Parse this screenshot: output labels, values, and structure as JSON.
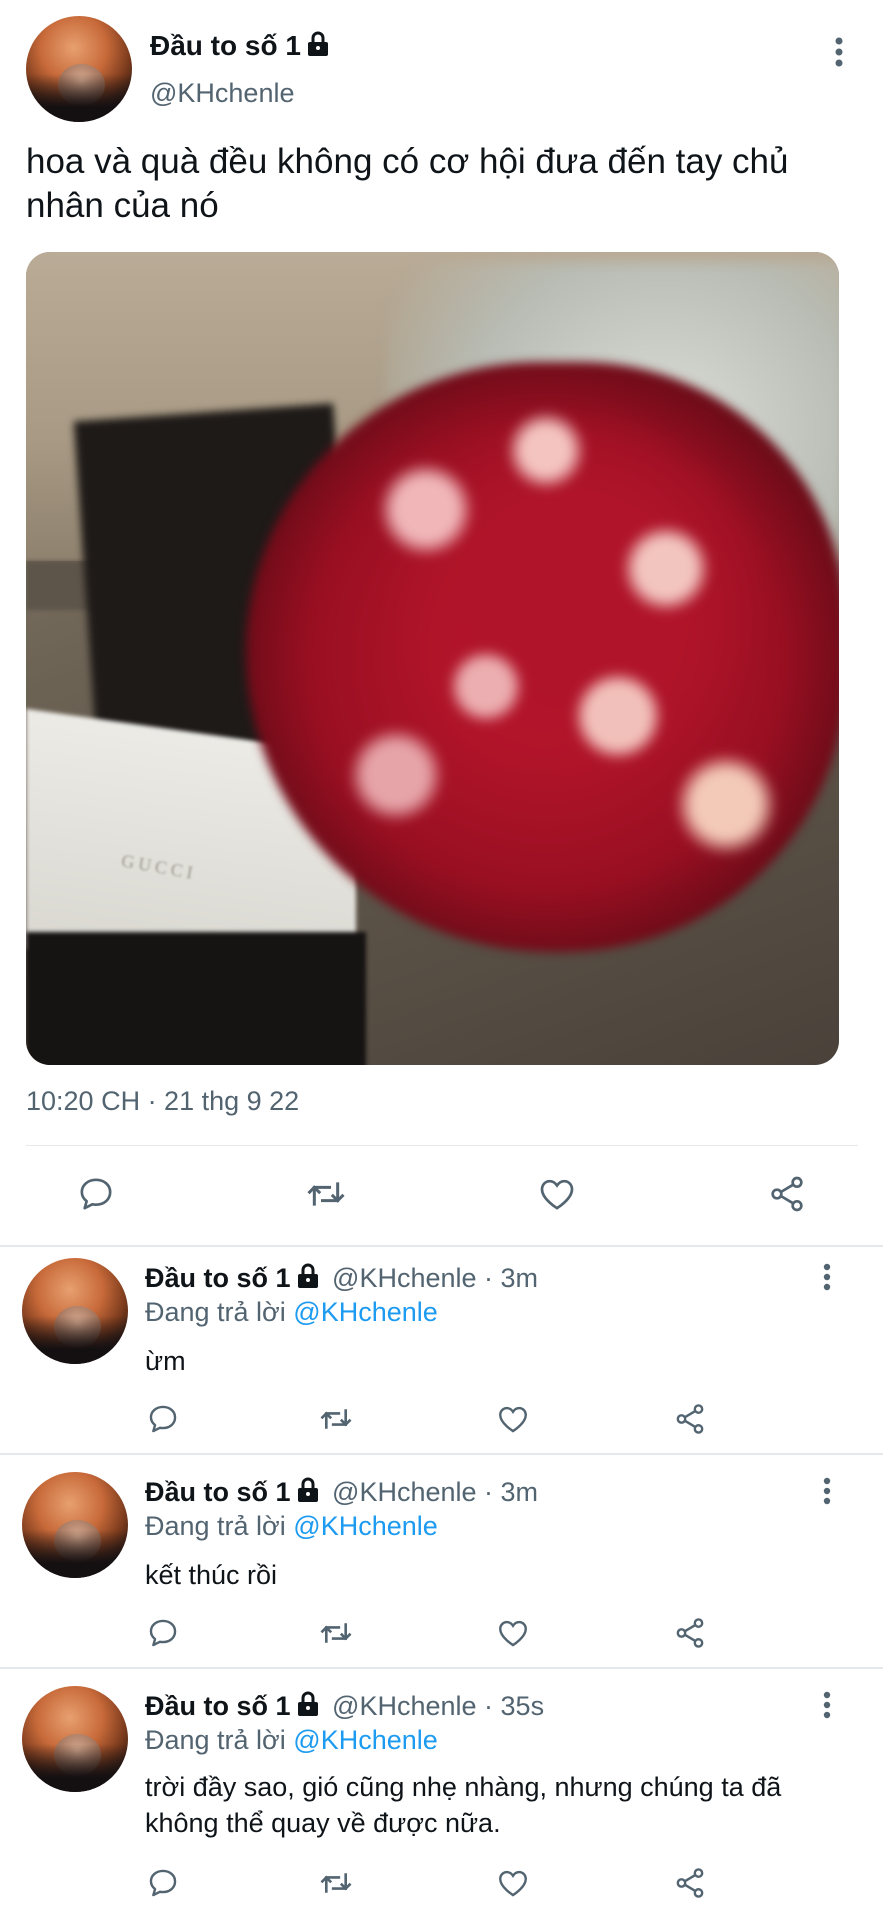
{
  "main_tweet": {
    "name": "Đầu to số 1",
    "handle": "@KHchenle",
    "text": "hoa và quà đều không có cơ hội đưa đến tay chủ nhân của nó",
    "photo_label": "GUCCI",
    "timestamp": "10:20 CH · 21 thg 9 22"
  },
  "icons": {
    "lock": "lock-icon",
    "more": "more-vertical-icon",
    "reply": "comment-icon",
    "retweet": "retweet-icon",
    "like": "heart-icon",
    "share": "share-icon"
  },
  "replying_prefix": "Đang trả lời",
  "replies": [
    {
      "name": "Đầu to số 1",
      "handle": "@KHchenle",
      "time": "3m",
      "replying_to": "@KHchenle",
      "text": "ừm"
    },
    {
      "name": "Đầu to số 1",
      "handle": "@KHchenle",
      "time": "3m",
      "replying_to": "@KHchenle",
      "text": "kết thúc rồi"
    },
    {
      "name": "Đầu to số 1",
      "handle": "@KHchenle",
      "time": "35s",
      "replying_to": "@KHchenle",
      "text": "trời đầy sao, gió cũng nhẹ nhàng, nhưng chúng ta đã không thể quay về được nữa."
    }
  ],
  "colors": {
    "text": "#0f1419",
    "secondary": "#536471",
    "accent": "#1d9bf0",
    "divider": "#e6e9ec"
  }
}
